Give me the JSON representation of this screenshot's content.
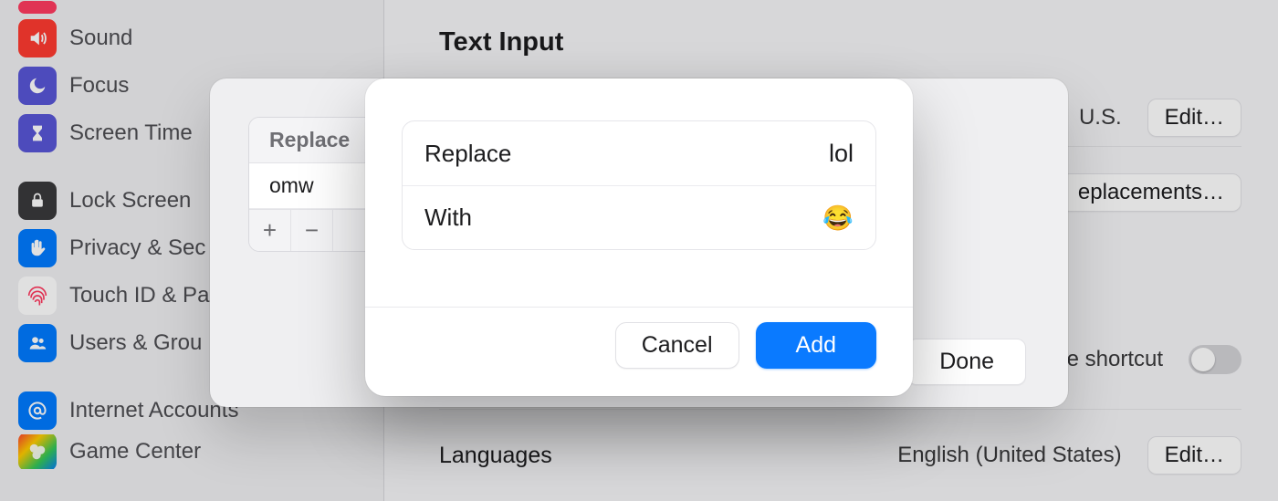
{
  "sidebar": {
    "items": [
      {
        "label": "Sound",
        "icon": "sound-icon",
        "color": "ic-red"
      },
      {
        "label": "Focus",
        "icon": "moon-icon",
        "color": "ic-indigo"
      },
      {
        "label": "Screen Time",
        "icon": "hourglass-icon",
        "color": "ic-indigo"
      },
      {
        "gap": true
      },
      {
        "label": "Lock Screen",
        "icon": "lock-icon",
        "color": "ic-gray"
      },
      {
        "label": "Privacy & Sec",
        "icon": "hand-icon",
        "color": "ic-blue"
      },
      {
        "label": "Touch ID & Pa",
        "icon": "fingerprint-icon",
        "color": "ic-red"
      },
      {
        "label": "Users & Grou",
        "icon": "users-icon",
        "color": "ic-blue"
      },
      {
        "gap": true
      },
      {
        "label": "Internet Accounts",
        "icon": "at-icon",
        "color": "ic-blue"
      },
      {
        "label": "Game Center",
        "icon": "game-icon",
        "color": "ic-gray"
      }
    ]
  },
  "main": {
    "section_title": "Text Input",
    "input_sources_value": "U.S.",
    "edit_button": "Edit…",
    "replacements_button_partial": "eplacements…",
    "shortcut_label_partial": "e shortcut",
    "shortcut_on": false,
    "languages_label": "Languages",
    "languages_value": "English (United States)",
    "languages_edit": "Edit…"
  },
  "sheet": {
    "header_replace": "Replace",
    "rows": [
      {
        "replace": "omw"
      }
    ],
    "add_icon_label": "+",
    "remove_icon_label": "−",
    "done": "Done"
  },
  "modal": {
    "replace_label": "Replace",
    "replace_value": "lol",
    "with_label": "With",
    "with_value": "😂",
    "cancel": "Cancel",
    "add": "Add"
  }
}
